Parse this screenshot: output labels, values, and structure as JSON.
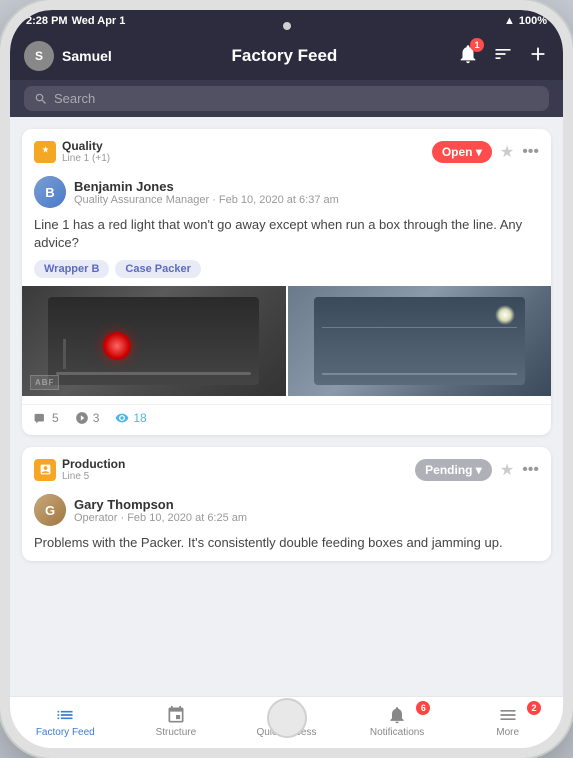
{
  "device": {
    "status_bar": {
      "time": "2:28 PM",
      "date": "Wed Apr 1",
      "wifi": "100%",
      "battery": "100%"
    },
    "camera_dot": true,
    "home_button": true
  },
  "header": {
    "user": "Samuel",
    "title": "Factory Feed",
    "notification_count": "1"
  },
  "search": {
    "placeholder": "Search"
  },
  "posts": [
    {
      "id": 1,
      "category": "Quality",
      "category_line": "Line 1 (+1)",
      "status": "Open",
      "status_type": "open",
      "author_name": "Benjamin Jones",
      "author_role": "Quality Assurance Manager",
      "author_date": "Feb 10, 2020 at 6:37 am",
      "body": "Line 1 has a red light that won't go away except when run a box through the line. Any advice?",
      "tags": [
        "Wrapper B",
        "Case Packer"
      ],
      "has_images": true,
      "image_overlay": "ABF",
      "comments_count": "5",
      "reactions_count": "3",
      "views_count": "18"
    },
    {
      "id": 2,
      "category": "Production",
      "category_line": "Line 5",
      "status": "Pending",
      "status_type": "pending",
      "author_name": "Gary Thompson",
      "author_role": "Operator",
      "author_date": "Feb 10, 2020 at 6:25 am",
      "body": "Problems with the Packer. It's consistently double feeding boxes and jamming up.",
      "tags": [],
      "has_images": false,
      "comments_count": "0",
      "reactions_count": "0",
      "views_count": "0"
    }
  ],
  "bottom_nav": {
    "items": [
      {
        "id": "factory-feed",
        "label": "Factory Feed",
        "active": true,
        "badge": null
      },
      {
        "id": "structure",
        "label": "Structure",
        "active": false,
        "badge": null
      },
      {
        "id": "quick-access",
        "label": "Quick Access",
        "active": false,
        "badge": null
      },
      {
        "id": "notifications",
        "label": "Notifications",
        "active": false,
        "badge": "6"
      },
      {
        "id": "more",
        "label": "More",
        "active": false,
        "badge": "2"
      }
    ]
  }
}
